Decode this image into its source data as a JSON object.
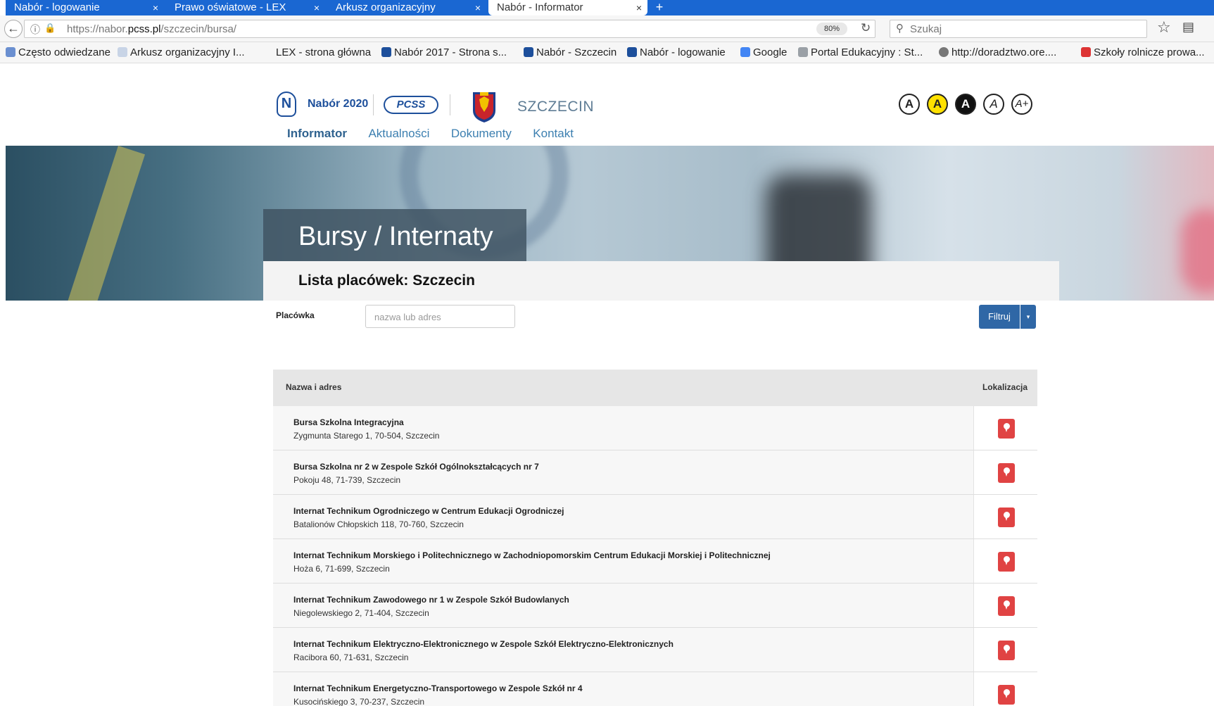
{
  "browser": {
    "tabs": [
      {
        "label": "Nabór - logowanie",
        "active": false
      },
      {
        "label": "Prawo oświatowe - LEX",
        "active": false
      },
      {
        "label": "Arkusz organizacyjny",
        "active": false
      },
      {
        "label": "Nabór - Informator",
        "active": true
      }
    ],
    "tab_close": "×",
    "new_tab": "+",
    "back": "←",
    "info_icon": "ⓘ",
    "lock_icon": "🔒",
    "url_prefix": "https://nabor.",
    "url_domain": "pcss.pl",
    "url_path": "/szczecin/bursa/",
    "zoom": "80%",
    "reload_icon": "↻",
    "search_placeholder": "Szukaj",
    "search_icon": "⚲",
    "star_icon": "☆",
    "library_icon": "▤",
    "bookmarks": [
      {
        "label": "Często odwiedzane",
        "icon_color": "#6a8fd0"
      },
      {
        "label": "Arkusz organizacyjny I...",
        "icon_color": "#c8d4e6"
      },
      {
        "label": "LEX - strona główna",
        "icon_color": ""
      },
      {
        "label": "Nabór 2017 - Strona s...",
        "icon_color": "#1d4f9b"
      },
      {
        "label": "Nabór - Szczecin",
        "icon_color": "#1d4f9b"
      },
      {
        "label": "Nabór - logowanie",
        "icon_color": "#1d4f9b"
      },
      {
        "label": "Google",
        "icon_color": "#4285f4"
      },
      {
        "label": "Portal Edukacyjny : St...",
        "icon_color": "#9aa0a6"
      },
      {
        "label": "http://doradztwo.ore....",
        "icon_color": "#777777"
      },
      {
        "label": "Szkoły rolnicze prowa...",
        "icon_color": "#d33"
      }
    ]
  },
  "header": {
    "brand_n": "N",
    "brand_title": "Nabór 2020",
    "pcss_logo": "PCSS",
    "city_name": "SZCZECIN"
  },
  "accessibility": [
    {
      "label": "A",
      "variant": "default"
    },
    {
      "label": "A",
      "variant": "yellow"
    },
    {
      "label": "A",
      "variant": "dark"
    },
    {
      "label": "A",
      "variant": "italic"
    },
    {
      "label": "A+",
      "variant": "italic"
    }
  ],
  "menu": [
    {
      "label": "Informator",
      "active": true
    },
    {
      "label": "Aktualności",
      "active": false
    },
    {
      "label": "Dokumenty",
      "active": false
    },
    {
      "label": "Kontakt",
      "active": false
    }
  ],
  "hero": {
    "title": "Bursy / Internaty",
    "list_title": "Lista placówek: Szczecin"
  },
  "filter": {
    "label": "Placówka",
    "placeholder": "nazwa lub adres",
    "button_label": "Filtruj",
    "caret": "▾"
  },
  "table": {
    "col_name": "Nazwa i adres",
    "col_location": "Lokalizacja",
    "rows": [
      {
        "name": "Bursa Szkolna Integracyjna",
        "address": "Zygmunta Starego 1, 70-504, Szczecin"
      },
      {
        "name": "Bursa Szkolna nr 2 w Zespole Szkół Ogólnokształcących nr 7",
        "address": "Pokoju 48, 71-739, Szczecin"
      },
      {
        "name": "Internat Technikum Ogrodniczego w Centrum Edukacji Ogrodniczej",
        "address": "Batalionów Chłopskich 118, 70-760, Szczecin"
      },
      {
        "name": "Internat Technikum Morskiego i Politechnicznego w Zachodniopomorskim Centrum Edukacji Morskiej i Politechnicznej",
        "address": "Hoża 6, 71-699, Szczecin"
      },
      {
        "name": "Internat Technikum Zawodowego nr 1 w Zespole Szkół Budowlanych",
        "address": "Niegolewskiego 2, 71-404, Szczecin"
      },
      {
        "name": "Internat Technikum Elektryczno-Elektronicznego w Zespole Szkół Elektryczno-Elektronicznych",
        "address": "Racibora 60, 71-631, Szczecin"
      },
      {
        "name": "Internat Technikum Energetyczno-Transportowego w Zespole Szkół nr 4",
        "address": "Kusocińskiego 3, 70-237, Szczecin"
      }
    ]
  },
  "colors": {
    "primary": "#2f67a6",
    "menu_active": "#2f628f",
    "pin": "#e04343",
    "browser_tabbar": "#1a67d2"
  }
}
